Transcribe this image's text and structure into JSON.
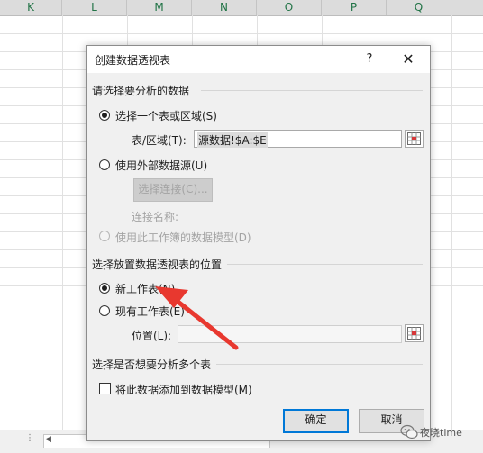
{
  "sheet": {
    "columns": [
      "K",
      "L",
      "M",
      "N",
      "O",
      "P",
      "Q"
    ]
  },
  "dialog": {
    "title": "创建数据透视表",
    "help_label": "?",
    "close_label": "✕",
    "section1": {
      "heading": "请选择要分析的数据",
      "option_range": "选择一个表或区域(S)",
      "range_label": "表/区域(T):",
      "range_value": "源数据!$A:$E",
      "option_external": "使用外部数据源(U)",
      "choose_connection": "选择连接(C)...",
      "connection_name_label": "连接名称:",
      "option_datamodel": "使用此工作簿的数据模型(D)"
    },
    "section2": {
      "heading": "选择放置数据透视表的位置",
      "option_new_sheet": "新工作表(N)",
      "option_existing_sheet": "现有工作表(E)",
      "location_label": "位置(L):",
      "location_value": ""
    },
    "section3": {
      "heading": "选择是否想要分析多个表",
      "add_to_model": "将此数据添加到数据模型(M)"
    },
    "ok_label": "确定",
    "cancel_label": "取消"
  },
  "selection": {
    "source": "range",
    "destination": "new_sheet",
    "add_to_data_model": false
  },
  "watermark": {
    "text": "夜晓time"
  },
  "colors": {
    "accent": "#0078d7",
    "annotation_arrow": "#e8382f",
    "column_header_text": "#217346"
  }
}
